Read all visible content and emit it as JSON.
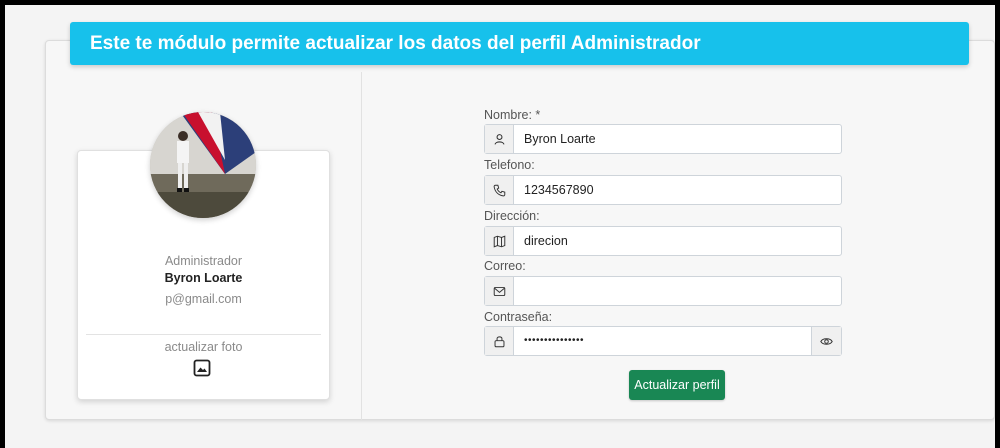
{
  "header": {
    "title": "Este te módulo permite actualizar los datos del perfil Administrador"
  },
  "profile": {
    "role": "Administrador",
    "name": "Byron Loarte",
    "email": "p@gmail.com",
    "photo_label": "actualizar foto",
    "photo_icon": "image-icon"
  },
  "form": {
    "fields": [
      {
        "label": "Nombre: *",
        "value": "Byron Loarte",
        "icon": "user-icon"
      },
      {
        "label": "Telefono:",
        "value": "1234567890",
        "icon": "phone-icon"
      },
      {
        "label": "Dirección:",
        "value": "direcion",
        "icon": "map-icon"
      },
      {
        "label": "Correo:",
        "value": "",
        "icon": "envelope-icon"
      },
      {
        "label": "Contraseña:",
        "value": "•••••••••••••••",
        "icon": "lock-icon",
        "toggle_icon": "eye-icon"
      }
    ],
    "submit_label": "Actualizar perfil"
  },
  "colors": {
    "header": "#17c1eb",
    "button": "#198754"
  }
}
